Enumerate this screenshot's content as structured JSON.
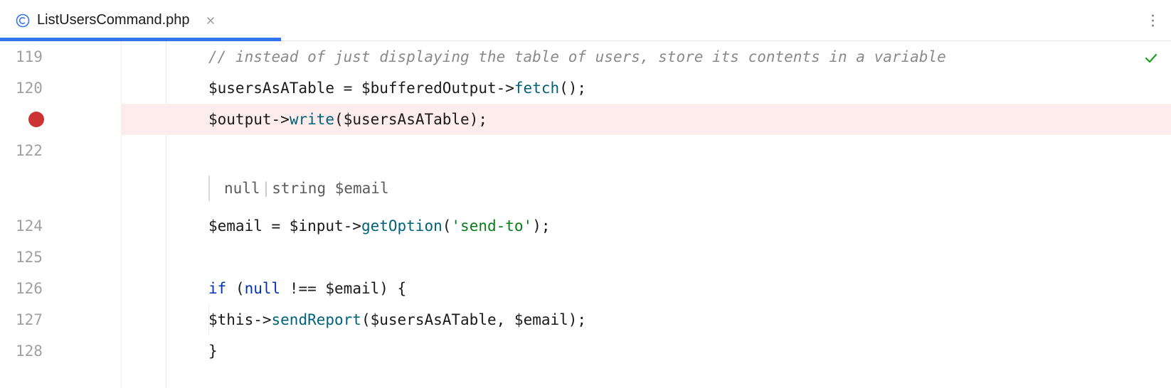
{
  "tab": {
    "filename": "ListUsersCommand.php"
  },
  "editor": {
    "lines": {
      "l119": {
        "num": "119",
        "comment": "// instead of just displaying the table of users, store its contents in a variable"
      },
      "l120": {
        "num": "120",
        "v1": "$usersAsATable",
        "op": " = ",
        "v2": "$bufferedOutput",
        "arrow": "->",
        "m": "fetch",
        "tail": "();"
      },
      "l121": {
        "num": "",
        "v1": "$output",
        "arrow": "->",
        "m": "write",
        "open": "(",
        "v2": "$usersAsATable",
        "close": ");"
      },
      "l122": {
        "num": "122"
      },
      "inlay": {
        "t1": "null",
        "t2": "string",
        "var": " $email"
      },
      "l124": {
        "num": "124",
        "v1": "$email",
        "op": " = ",
        "v2": "$input",
        "arrow": "->",
        "m": "getOption",
        "open": "(",
        "str": "'send-to'",
        "close": ");"
      },
      "l125": {
        "num": "125"
      },
      "l126": {
        "num": "126",
        "kw": "if",
        "open": " (",
        "nul": "null",
        "neq": " !== ",
        "v": "$email",
        "close": ") ",
        "brace": "{"
      },
      "l127": {
        "num": "127",
        "this": "$this",
        "arrow": "->",
        "m": "sendReport",
        "open": "(",
        "v1": "$usersAsATable",
        "comma": ", ",
        "v2": "$email",
        "close": ");"
      },
      "l128": {
        "num": "128",
        "brace": "}"
      }
    }
  }
}
